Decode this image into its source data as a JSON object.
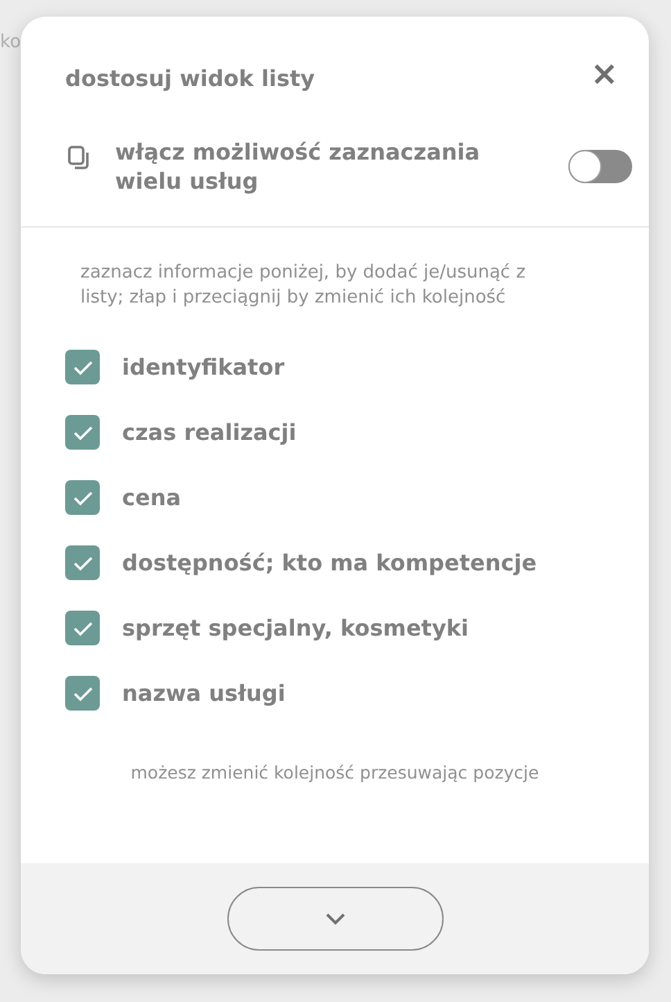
{
  "background": {
    "text": "ko"
  },
  "dialog": {
    "title": "dostosuj widok listy",
    "close": "×"
  },
  "multi_select": {
    "label": "włącz możliwość zaznaczania wielu usług",
    "on": false
  },
  "instructions": "zaznacz informacje poniżej, by dodać je/usunąć z listy; złap i przeciągnij by zmienić ich kolejność",
  "fields": [
    {
      "label": "identyfikator",
      "checked": true
    },
    {
      "label": "czas realizacji",
      "checked": true
    },
    {
      "label": "cena",
      "checked": true
    },
    {
      "label": "dostępność; kto ma kompetencje",
      "checked": true
    },
    {
      "label": "sprzęt specjalny, kosmetyki",
      "checked": true
    },
    {
      "label": "nazwa usługi",
      "checked": true
    }
  ],
  "hint": "możesz zmienić kolejność przesuwając pozycje"
}
